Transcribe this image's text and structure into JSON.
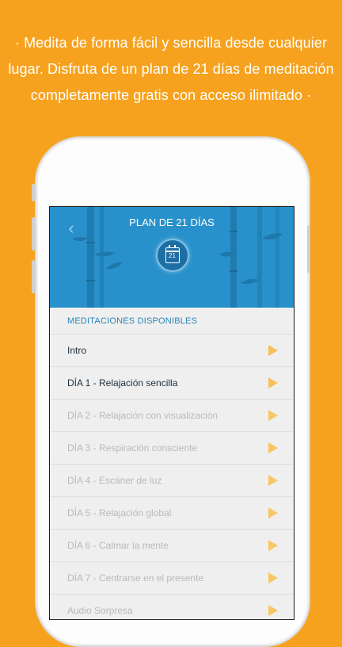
{
  "promo": {
    "line1": "· Medita de forma fácil y sencilla desde cualquier",
    "line2": "lugar. Disfruta de un plan de 21 días de meditación",
    "line3": "completamente gratis con acceso ilimitado ·"
  },
  "header": {
    "title": "PLAN DE 21 DÍAS",
    "back_icon": "chevron-left-icon",
    "calendar_number": "21"
  },
  "section": {
    "label": "MEDITACIONES DISPONIBLES"
  },
  "meditations": [
    {
      "label": "Intro",
      "state": "active"
    },
    {
      "label": "DÍA 1 - Relajación sencilla",
      "state": "active"
    },
    {
      "label": "DÍA 2 - Relajación con visualización",
      "state": "inactive"
    },
    {
      "label": "DÍA 3 - Respiración consciente",
      "state": "inactive"
    },
    {
      "label": "DÍA 4 - Escáner de luz",
      "state": "inactive"
    },
    {
      "label": "DÍA 5 - Relajación global",
      "state": "inactive"
    },
    {
      "label": "DÍA 6 - Calmar la mente",
      "state": "inactive"
    },
    {
      "label": "DÍA 7 - Centrarse en el presente",
      "state": "inactive"
    },
    {
      "label": "Audio Sorpresa",
      "state": "inactive"
    }
  ],
  "colors": {
    "background": "#F6A21E",
    "header_blue": "#2891CB",
    "play_icon": "#F8C765",
    "section_label": "#2a86b8"
  }
}
